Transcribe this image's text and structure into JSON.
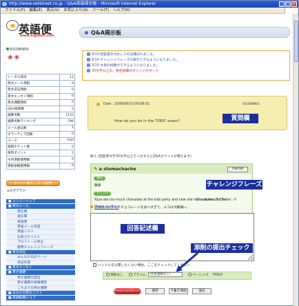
{
  "window": {
    "title": "http://www.netstreet.co.jp - Q&A英語掲示板 - Microsoft Internet Explorer",
    "min": "_",
    "max": "□",
    "close": "×"
  },
  "menu": [
    "ファイル(F)",
    "編集(E)",
    "表示(V)",
    "お気に入り(A)",
    "ツール(T)",
    "ヘルプ(H)"
  ],
  "sidebar": {
    "logo_text": "英語便",
    "logo_url": "www.eigobin.com",
    "user_id": "EIGOBIN09",
    "flowers": "❀❀",
    "stats": [
      {
        "label": "トータル得点",
        "value": "11"
      },
      {
        "label": "英文メール添削",
        "value": "6"
      },
      {
        "label": "英文日記添削",
        "value": "0"
      },
      {
        "label": "英文エッセイ添削",
        "value": "0"
      },
      {
        "label": "英文課題添削",
        "value": "0"
      },
      {
        "label": "Q&A投稿数",
        "value": "5"
      },
      {
        "label": "通算点数",
        "value": "1125"
      },
      {
        "label": "通算点数ランキング",
        "value": "796"
      },
      {
        "label": "メール送信数",
        "value": "1"
      },
      {
        "label": "ボランティア回数",
        "value": "0"
      },
      {
        "label": "コース",
        "value": "mail"
      },
      {
        "label": "投稿チケット数",
        "value": "0"
      },
      {
        "label": "保有ポイント",
        "value": "1"
      },
      {
        "label": "今月添削使用数",
        "value": "0"
      },
      {
        "label": "添削依頼使用数",
        "value": "0"
      }
    ],
    "mini_note": "登録数/P1 ... (FS@K)",
    "orange_button": "ポイント購入・コース変更",
    "logout": "▸ログアウト",
    "nav": [
      {
        "type": "h",
        "label": "■ メンバートップ"
      },
      {
        "type": "h",
        "label": "■ 英文メール"
      },
      {
        "type": "i",
        "label": "受信箱"
      },
      {
        "type": "i",
        "label": "送信箱"
      },
      {
        "type": "i",
        "label": "英語便"
      },
      {
        "type": "i",
        "label": "英語メール作成"
      },
      {
        "type": "i",
        "label": "英語リスト"
      },
      {
        "type": "i",
        "label": "お知らせリスト"
      },
      {
        "type": "i",
        "label": "プロフィール修正"
      },
      {
        "type": "i",
        "label": "使用チャレンジフレーズ"
      },
      {
        "type": "h",
        "label": "■ 英文日記"
      },
      {
        "type": "i",
        "label": "みんなの日記ページ"
      },
      {
        "type": "i",
        "label": "日記作成"
      },
      {
        "type": "h",
        "label": "■ 英文エッセイ"
      },
      {
        "type": "h",
        "label": "■ 英文課題"
      },
      {
        "type": "i",
        "label": "英文課題の提出"
      },
      {
        "type": "i",
        "label": "英文課題の結果報告"
      },
      {
        "type": "i",
        "label": "これまでの英文課題"
      },
      {
        "type": "h",
        "label": "■ あなたの英文リスト"
      },
      {
        "type": "h",
        "label": "■ 英語転職ジョブ"
      }
    ]
  },
  "main": {
    "title": "Q&A掲示板",
    "notices": [
      {
        "text": "9/10 回答表示がおしりのば補ばれました。",
        "red": false
      },
      {
        "text": "9/10 チャレンジフレーズが表示できるようになりました。",
        "red": false
      },
      {
        "text": "9/10 文章の投稿ができるようになりました。",
        "red": false
      },
      {
        "text": "30文字以上の、英名投稿のポイントサポート",
        "red": true
      }
    ],
    "question": {
      "date": "Date : 2009/09/10 00:08:01",
      "user": "EIGOBIN01",
      "text": "How do you do in the TOEIC exam?"
    },
    "label_question": "質問欄",
    "instruction": "新人 (回答英文字30文字以上で入力するとQ&Aカウントが増えます)",
    "phrase": {
      "heading": "a stomachache",
      "cancel": "Cancel",
      "tag_meaning": "意味",
      "meaning": "腹痛",
      "tag_example": "サンプル",
      "example_en": "Yuya ate too much chocolate at the kids party and now she has a stomachache.",
      "example_ja": "子供のパーティでチョコレートを食べすぎて、ユコは今腹痛い。"
    },
    "label_phrase": "チャレンジフレーズ",
    "counter": "Character : 0  /  Ticket : 0",
    "spell": "Check spelling",
    "label_answer": "回答記述欄",
    "label_check": "添削の提出チェック",
    "agree_text": "ハンドルを公開したくない場合、ここをチェックしてください",
    "options": {
      "free": "添削なし",
      "premium": "プライム",
      "select_value": "(先生選択なし)",
      "basic": "ベーシック",
      "help": "HELP"
    },
    "buttons": {
      "challenge": "チャレンジフレーズ",
      "save": "保存",
      "draft": "下書き添削",
      "submit": "送信"
    }
  },
  "colors": {
    "label_bg": "#1d2f9e",
    "phrase_bg": "#d8ecbd",
    "question_bg": "#f6edb1",
    "nav_header": "#2f6cc8"
  }
}
